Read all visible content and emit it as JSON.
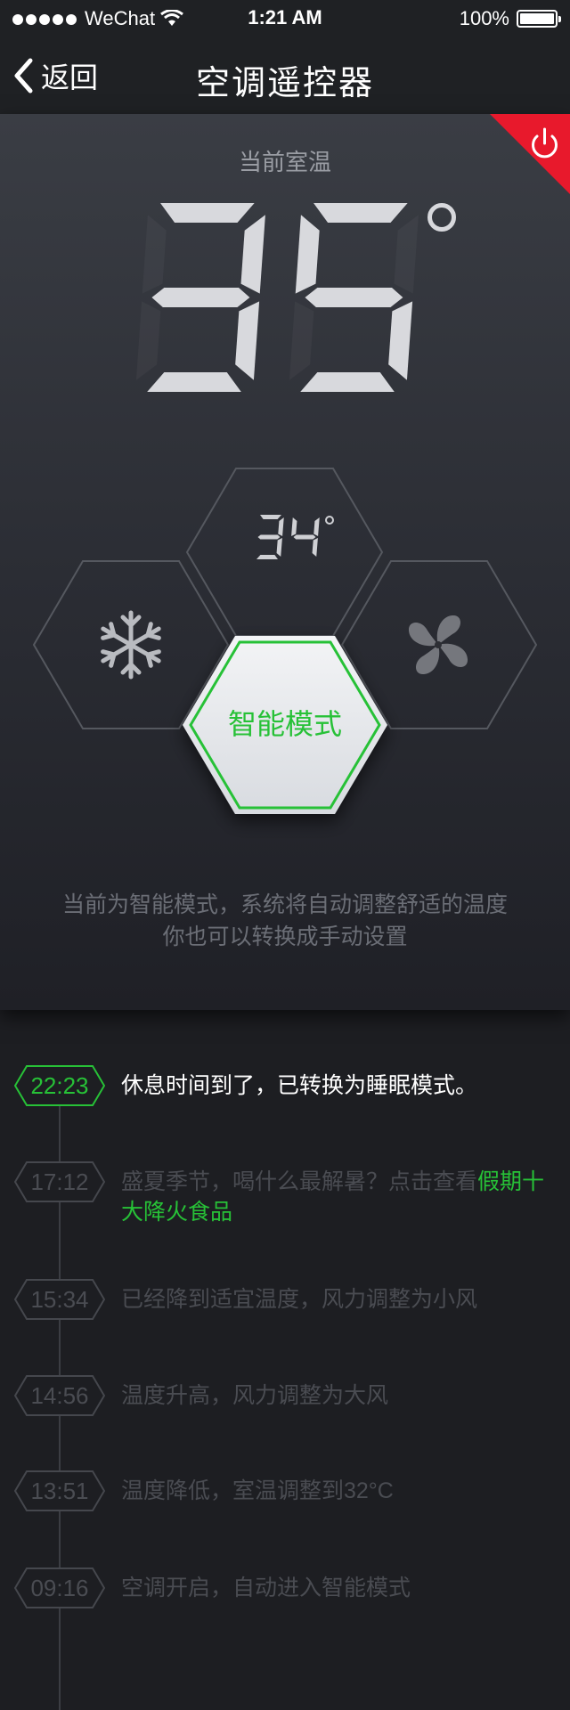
{
  "status_bar": {
    "carrier": "WeChat",
    "time": "1:21 AM",
    "battery": "100%"
  },
  "nav": {
    "back_label": "返回",
    "title": "空调遥控器"
  },
  "panel": {
    "current_temp_label": "当前室温",
    "current_temp": "35",
    "target_temp": "34",
    "modes": {
      "cool_icon": "snowflake-icon",
      "fan_icon": "fan-icon",
      "smart_label": "智能模式"
    },
    "hint_line1": "当前为智能模式，系统将自动调整舒适的温度",
    "hint_line2": "你也可以转换成手动设置"
  },
  "colors": {
    "accent": "#27c137",
    "power": "#e8192c",
    "bg": "#1d1e22"
  },
  "timeline": [
    {
      "time": "22:23",
      "text": "休息时间到了，已转换为睡眠模式。",
      "active": true
    },
    {
      "time": "17:12",
      "text": "盛夏季节，喝什么最解暑？点击查看",
      "link": "假期十大降火食品"
    },
    {
      "time": "15:34",
      "text": "已经降到适宜温度，风力调整为小风"
    },
    {
      "time": "14:56",
      "text": "温度升高，风力调整为大风"
    },
    {
      "time": "13:51",
      "text": "温度降低，室温调整到32°C"
    },
    {
      "time": "09:16",
      "text": "空调开启，自动进入智能模式"
    }
  ]
}
